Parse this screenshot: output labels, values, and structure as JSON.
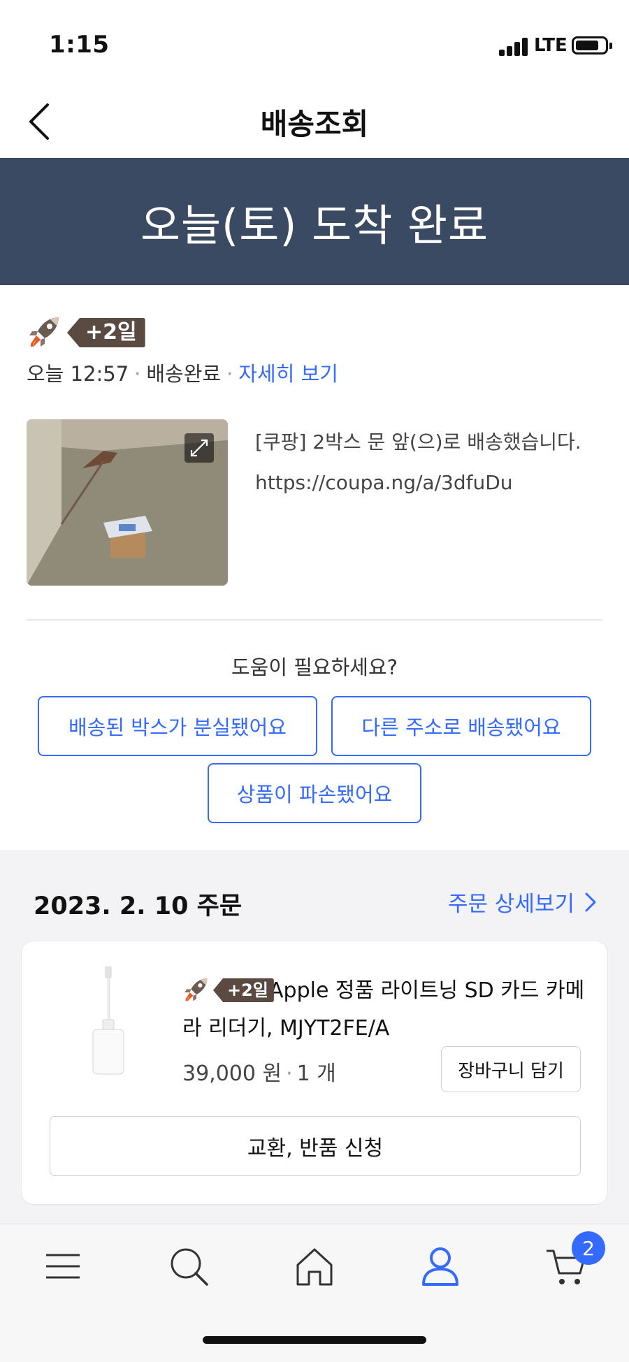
{
  "status_bar": {
    "time": "1:15",
    "network": "LTE"
  },
  "header": {
    "title": "배송조회"
  },
  "banner": {
    "text": "오늘(토) 도착 완료"
  },
  "delivery": {
    "badge": "+2일",
    "time": "오늘 12:57",
    "status": "배송완료",
    "detail_link": "자세히 보기",
    "message_line1": "[쿠팡] 2박스 문 앞(으)로 배송했습니다.",
    "message_line2": "https://coupa.ng/a/3dfuDu"
  },
  "help": {
    "title": "도움이 필요하세요?",
    "buttons": [
      "배송된 박스가 분실됐어요",
      "다른 주소로 배송됐어요",
      "상품이 파손됐어요"
    ]
  },
  "order": {
    "date": "2023. 2. 10 주문",
    "detail_link": "주문 상세보기",
    "product": {
      "badge": "+2일",
      "name": "Apple 정품 라이트닝 SD 카드 카메라 리더기, MJYT2FE/A",
      "price": "39,000 원",
      "quantity": "1 개",
      "cart_button": "장바구니 담기"
    },
    "return_button": "교환, 반품 신청"
  },
  "tabbar": {
    "cart_count": "2"
  },
  "colors": {
    "accent": "#346aff",
    "banner": "#3b4a63",
    "badge": "#5a4a42"
  }
}
